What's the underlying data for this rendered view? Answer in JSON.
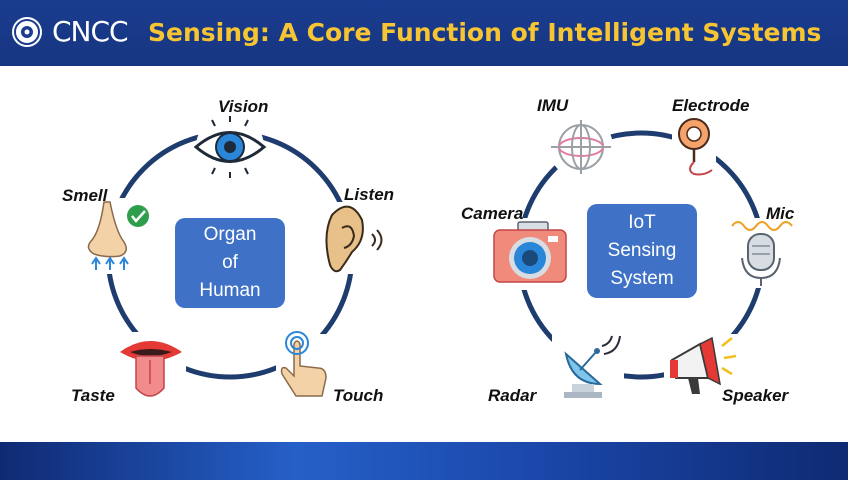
{
  "header": {
    "logo_text": "CNCC",
    "title": "Sensing: A Core Function of Intelligent Systems"
  },
  "human": {
    "center_lines": [
      "Organ",
      "of",
      "Human"
    ],
    "labels": {
      "vision": "Vision",
      "listen": "Listen",
      "touch": "Touch",
      "taste": "Taste",
      "smell": "Smell"
    }
  },
  "iot": {
    "center_lines": [
      "IoT",
      "Sensing",
      "System"
    ],
    "labels": {
      "imu": "IMU",
      "electrode": "Electrode",
      "mic": "Mic",
      "speaker": "Speaker",
      "radar": "Radar",
      "camera": "Camera"
    }
  },
  "colors": {
    "header_bg": "#1b3d8f",
    "title": "#f7c531",
    "box": "#3f72c7",
    "ring": "#1e3d6e"
  }
}
